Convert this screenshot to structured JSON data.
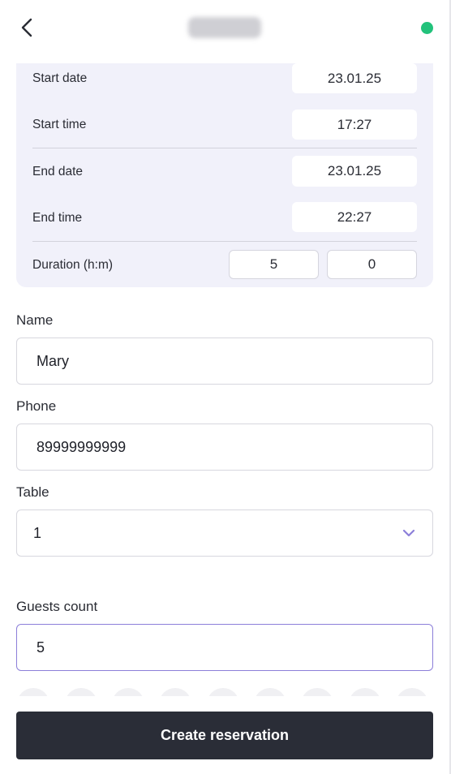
{
  "header": {
    "back_icon": "chevron-left-icon",
    "title_obscured": "",
    "status_color": "#22c27b"
  },
  "time_card": {
    "start_date_label": "Start date",
    "start_date_value": "23.01.25",
    "start_time_label": "Start time",
    "start_time_value": "17:27",
    "end_date_label": "End date",
    "end_date_value": "23.01.25",
    "end_time_label": "End time",
    "end_time_value": "22:27",
    "duration_label": "Duration (h:m)",
    "duration_hours": "5",
    "duration_minutes": "0"
  },
  "form": {
    "name_label": "Name",
    "name_value": "Mary",
    "phone_label": "Phone",
    "phone_value": "89999999999",
    "table_label": "Table",
    "table_value": "1",
    "table_chevron_icon": "chevron-down-icon",
    "guests_label": "Guests count",
    "guests_value": "5"
  },
  "actions": {
    "create_label": "Create reservation"
  },
  "colors": {
    "accent": "#8c7fd9",
    "card_bg": "#f1f1fa",
    "button_bg": "#2a2d37",
    "status": "#22c27b"
  }
}
